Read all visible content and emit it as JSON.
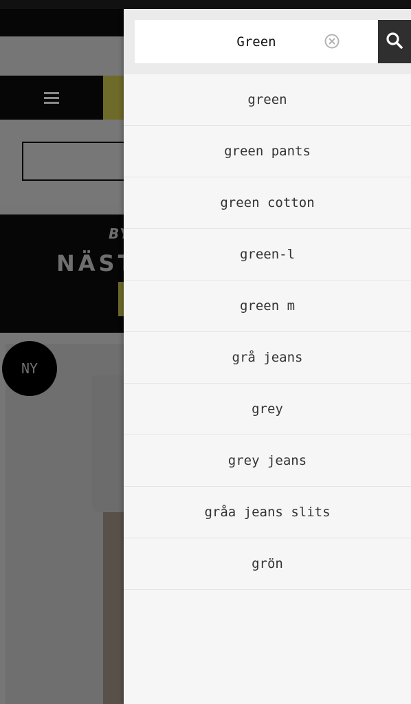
{
  "background": {
    "promo_small": "BY",
    "promo_big": "NÄST",
    "badge": "NY"
  },
  "search": {
    "value": "Green",
    "clear_icon": "close-circle-icon",
    "submit_icon": "search-icon"
  },
  "suggestions": [
    "green",
    "green pants",
    "green cotton",
    "green-l",
    "green m",
    "grå jeans",
    "grey",
    "grey jeans",
    "gråa jeans slits",
    "grön"
  ],
  "colors": {
    "drawer_bg": "#f7f6f6",
    "header_bg": "#ebebeb",
    "search_button": "#2f2f2f",
    "accent_yellow": "#e2d54c"
  }
}
